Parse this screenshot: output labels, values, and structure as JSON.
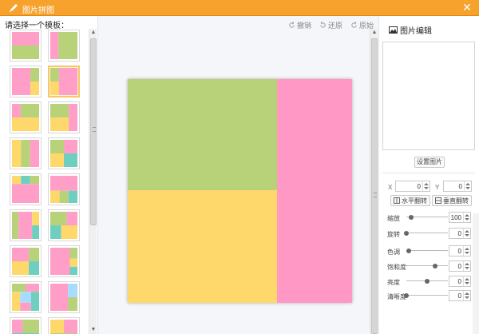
{
  "window": {
    "title": "图片拼图",
    "close_icon": "close-icon"
  },
  "left": {
    "prompt": "请选择一个模板："
  },
  "templates": [
    {
      "id": 1,
      "cells": [
        [
          "#ff9ec7",
          0,
          0,
          1,
          0.5
        ],
        [
          "#b8d27a",
          0,
          0.5,
          1,
          0.5
        ]
      ]
    },
    {
      "id": 2,
      "cells": [
        [
          "#ff9ec7",
          0,
          0,
          0.3,
          1
        ],
        [
          "#b8d27a",
          0.3,
          0,
          0.7,
          1
        ]
      ]
    },
    {
      "id": 3,
      "cells": [
        [
          "#ff9ec7",
          0,
          0,
          0.68,
          1
        ],
        [
          "#b8d27a",
          0.68,
          0,
          0.32,
          0.5
        ],
        [
          "#ffd86b",
          0.68,
          0.5,
          0.32,
          0.5
        ]
      ]
    },
    {
      "id": 4,
      "cells": [
        [
          "#b8d27a",
          0,
          0,
          0.32,
          0.5
        ],
        [
          "#ffd86b",
          0,
          0.5,
          0.32,
          0.5
        ],
        [
          "#ff9ec7",
          0.32,
          0,
          0.68,
          1
        ]
      ]
    },
    {
      "id": 5,
      "cells": [
        [
          "#ff9ec7",
          0,
          0,
          0.32,
          0.5
        ],
        [
          "#b8d27a",
          0.32,
          0,
          0.68,
          0.5
        ],
        [
          "#ffd86b",
          0,
          0.5,
          1,
          0.5
        ]
      ]
    },
    {
      "id": 6,
      "cells": [
        [
          "#b8d27a",
          0,
          0,
          0.68,
          0.5
        ],
        [
          "#ffd86b",
          0,
          0.5,
          0.68,
          0.5
        ],
        [
          "#ff9ec7",
          0.68,
          0,
          0.32,
          1
        ]
      ]
    },
    {
      "id": 7,
      "cells": [
        [
          "#ffd86b",
          0,
          0,
          0.33,
          1
        ],
        [
          "#b8d27a",
          0.33,
          0,
          0.34,
          1
        ],
        [
          "#ff9ec7",
          0.67,
          0,
          0.33,
          1
        ]
      ]
    },
    {
      "id": 8,
      "cells": [
        [
          "#b8d27a",
          0,
          0,
          0.5,
          0.5
        ],
        [
          "#ff9ec7",
          0.5,
          0,
          0.5,
          0.5
        ],
        [
          "#ffd86b",
          0,
          0.5,
          0.5,
          0.5
        ],
        [
          "#6ecfc0",
          0.5,
          0.5,
          0.5,
          0.5
        ]
      ]
    },
    {
      "id": 9,
      "cells": [
        [
          "#ffd86b",
          0,
          0,
          0.33,
          0.3
        ],
        [
          "#6ecfc0",
          0.33,
          0,
          0.34,
          0.3
        ],
        [
          "#b8d27a",
          0.67,
          0,
          0.33,
          0.3
        ],
        [
          "#ff9ec7",
          0,
          0.3,
          1,
          0.7
        ]
      ]
    },
    {
      "id": 10,
      "cells": [
        [
          "#ff9ec7",
          0,
          0,
          1,
          0.55
        ],
        [
          "#ffd86b",
          0,
          0.55,
          0.34,
          0.45
        ],
        [
          "#b8d27a",
          0.34,
          0.55,
          0.33,
          0.45
        ],
        [
          "#6ecfc0",
          0.67,
          0.55,
          0.33,
          0.45
        ]
      ]
    },
    {
      "id": 11,
      "cells": [
        [
          "#b8d27a",
          0,
          0,
          0.24,
          1
        ],
        [
          "#ff9ec7",
          0.24,
          0,
          0.5,
          1
        ],
        [
          "#ffd86b",
          0.74,
          0,
          0.26,
          0.5
        ],
        [
          "#6ecfc0",
          0.74,
          0.5,
          0.26,
          0.5
        ]
      ]
    },
    {
      "id": 12,
      "cells": [
        [
          "#b8d27a",
          0,
          0,
          0.6,
          0.5
        ],
        [
          "#ff9ec7",
          0.6,
          0,
          0.4,
          0.5
        ],
        [
          "#6ecfc0",
          0,
          0.5,
          0.4,
          0.5
        ],
        [
          "#ffd86b",
          0.4,
          0.5,
          0.6,
          0.5
        ]
      ]
    },
    {
      "id": 13,
      "cells": [
        [
          "#ff9ec7",
          0,
          0,
          0.62,
          0.5
        ],
        [
          "#b8d27a",
          0.62,
          0,
          0.38,
          0.5
        ],
        [
          "#ffd86b",
          0,
          0.5,
          0.62,
          0.5
        ],
        [
          "#6ecfc0",
          0.62,
          0.5,
          0.38,
          0.5
        ]
      ]
    },
    {
      "id": 14,
      "cells": [
        [
          "#ff9ec7",
          0,
          0,
          0.72,
          1
        ],
        [
          "#b8d27a",
          0.72,
          0,
          0.28,
          0.4
        ],
        [
          "#ffd86b",
          0.72,
          0.4,
          0.28,
          0.3
        ],
        [
          "#6ecfc0",
          0.72,
          0.7,
          0.28,
          0.3
        ]
      ]
    },
    {
      "id": 15,
      "cells": [
        [
          "#b8d27a",
          0,
          0,
          0.5,
          0.3
        ],
        [
          "#ff9ec7",
          0.5,
          0,
          0.5,
          0.3
        ],
        [
          "#ffd86b",
          0,
          0.3,
          0.3,
          0.7
        ],
        [
          "#a8dcff",
          0.3,
          0.3,
          0.4,
          0.4
        ],
        [
          "#6ecfc0",
          0.7,
          0.3,
          0.3,
          0.7
        ],
        [
          "#ff9ec7",
          0.3,
          0.7,
          0.4,
          0.3
        ]
      ]
    },
    {
      "id": 16,
      "cells": [
        [
          "#ff9ec7",
          0,
          0,
          0.65,
          1
        ],
        [
          "#a8dcff",
          0.65,
          0,
          0.35,
          0.5
        ],
        [
          "#b8d27a",
          0.65,
          0.5,
          0.35,
          0.5
        ]
      ]
    },
    {
      "id": 17,
      "cells": [
        [
          "#ff9ec7",
          0,
          0,
          0.4,
          0.5
        ],
        [
          "#b8d27a",
          0.4,
          0,
          0.6,
          0.5
        ],
        [
          "#6ecfc0",
          0,
          0.5,
          1,
          0.5
        ]
      ]
    },
    {
      "id": 18,
      "cells": [
        [
          "#ffd86b",
          0,
          0,
          0.5,
          0.5
        ],
        [
          "#ff9ec7",
          0.5,
          0,
          0.5,
          0.5
        ],
        [
          "#b8d27a",
          0,
          0.5,
          1,
          0.5
        ]
      ]
    }
  ],
  "selected_template": 4,
  "toolbar": [
    {
      "label": "撤销",
      "icon": "undo-icon"
    },
    {
      "label": "还原",
      "icon": "redo-icon"
    },
    {
      "label": "原始",
      "icon": "reset-icon"
    }
  ],
  "collage": {
    "cells": [
      {
        "name": "cell-top-left",
        "color": "#b8d27a"
      },
      {
        "name": "cell-bottom-left",
        "color": "#ffd86b"
      },
      {
        "name": "cell-right",
        "color": "#ff98c5"
      }
    ]
  },
  "editor": {
    "header": "图片编辑",
    "header_icon": "image-icon",
    "set_image": "设置图片",
    "x_label": "X",
    "x_value": "0",
    "y_label": "Y",
    "y_value": "0",
    "flip_h": "水平翻转",
    "flip_v": "垂直翻转",
    "adjustments": [
      {
        "label": "缩放",
        "value": "100",
        "level": 0.12
      },
      {
        "label": "旋转",
        "value": "0",
        "level": 0.0
      },
      {
        "label": "色调",
        "value": "0",
        "level": 0.05
      },
      {
        "label": "饱和度",
        "value": "0",
        "level": 0.7
      },
      {
        "label": "亮度",
        "value": "0",
        "level": 0.5
      },
      {
        "label": "清晰度",
        "value": "0",
        "level": 0.0
      }
    ]
  },
  "colors": {
    "titlebar": "#f7a22c",
    "accent_select": "#f5c66a"
  }
}
